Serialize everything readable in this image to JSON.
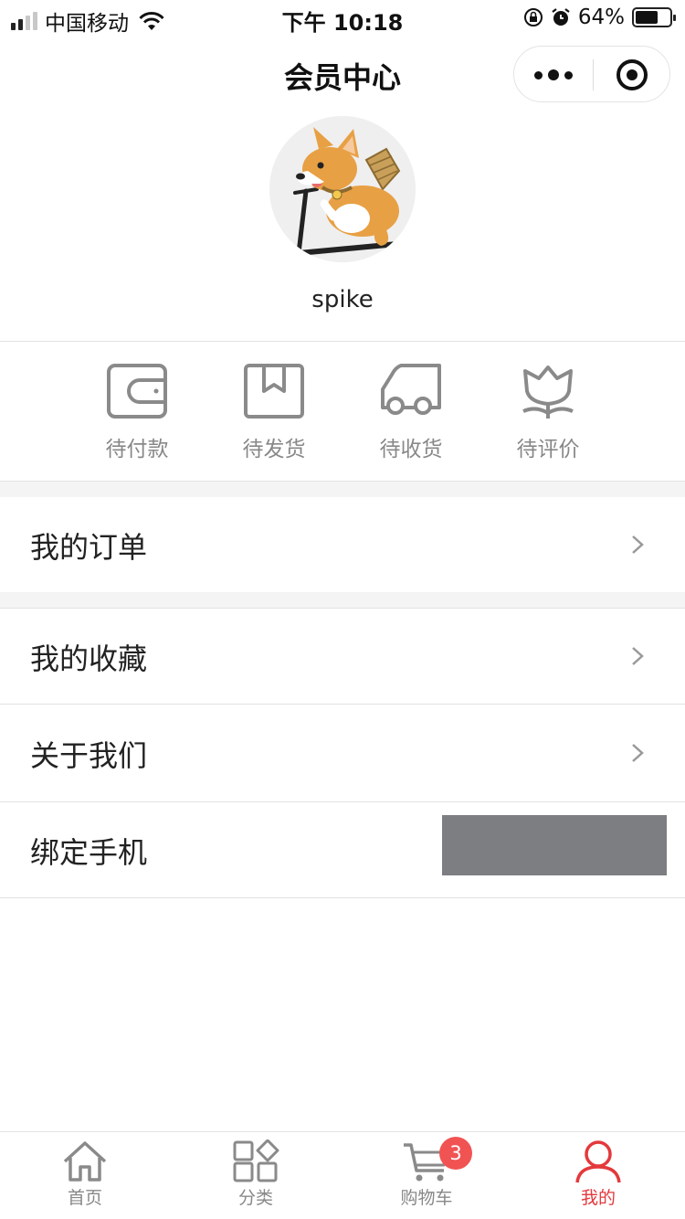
{
  "status_bar": {
    "carrier": "中国移动",
    "time": "下午 10:18",
    "battery": "64%",
    "battery_level": 0.64
  },
  "nav": {
    "title": "会员中心",
    "more_icon": "more-dots-icon",
    "close_icon": "target-close-icon"
  },
  "profile": {
    "username": "spike",
    "avatar_icon": "corgi-avatar"
  },
  "order_status": [
    {
      "label": "待付款",
      "icon": "wallet-icon"
    },
    {
      "label": "待发货",
      "icon": "package-icon"
    },
    {
      "label": "待收货",
      "icon": "truck-icon"
    },
    {
      "label": "待评价",
      "icon": "flower-icon"
    }
  ],
  "menu": {
    "orders": "我的订单",
    "favorites": "我的收藏",
    "about": "关于我们",
    "bind_phone": "绑定手机"
  },
  "tabs": [
    {
      "label": "首页",
      "icon": "home-icon"
    },
    {
      "label": "分类",
      "icon": "category-icon"
    },
    {
      "label": "购物车",
      "icon": "cart-icon",
      "badge": "3"
    },
    {
      "label": "我的",
      "icon": "user-icon",
      "active": true
    }
  ],
  "colors": {
    "accent": "#e4393c",
    "badge": "#f15353",
    "icon_gray": "#8a8a8a",
    "background_gap": "#f4f4f4"
  }
}
